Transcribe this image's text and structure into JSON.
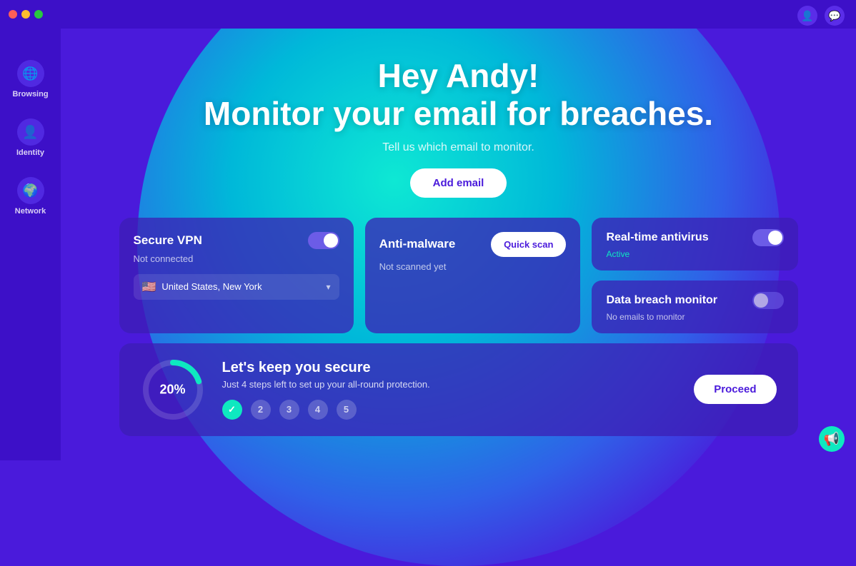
{
  "titleBar": {
    "trafficLights": [
      "red",
      "yellow",
      "green"
    ]
  },
  "topRightIcons": [
    {
      "name": "user-icon",
      "symbol": "👤"
    },
    {
      "name": "chat-icon",
      "symbol": "💬"
    }
  ],
  "sidebar": {
    "items": [
      {
        "id": "browsing",
        "label": "Browsing",
        "icon": "🌐"
      },
      {
        "id": "identity",
        "label": "Identity",
        "icon": "👤"
      },
      {
        "id": "network",
        "label": "Network",
        "icon": "🌍"
      }
    ]
  },
  "hero": {
    "title": "Hey Andy!\nMonitor your email for breaches.",
    "title_line1": "Hey Andy!",
    "title_line2": "Monitor your email for breaches.",
    "subtitle": "Tell us which email to monitor.",
    "add_email_label": "Add email"
  },
  "cards": {
    "vpn": {
      "title": "Secure VPN",
      "status": "Not connected",
      "toggle": "on",
      "location": {
        "flag": "🇺🇸",
        "text": "United States, New York"
      }
    },
    "antimalware": {
      "title": "Anti-malware",
      "status": "Not scanned yet",
      "quick_scan_label": "Quick scan"
    },
    "antivirus": {
      "title": "Real-time antivirus",
      "status": "Active",
      "toggle": "on"
    },
    "breach_monitor": {
      "title": "Data breach monitor",
      "status": "No emails to monitor",
      "toggle": "off"
    }
  },
  "security": {
    "progress_percent": "20%",
    "title": "Let's keep you secure",
    "description": "Just 4 steps left to set up your all-round protection.",
    "steps": [
      {
        "label": "✓",
        "done": true
      },
      {
        "label": "2",
        "done": false
      },
      {
        "label": "3",
        "done": false
      },
      {
        "label": "4",
        "done": false
      },
      {
        "label": "5",
        "done": false
      }
    ],
    "proceed_label": "Proceed"
  },
  "support": {
    "icon": "📢"
  }
}
